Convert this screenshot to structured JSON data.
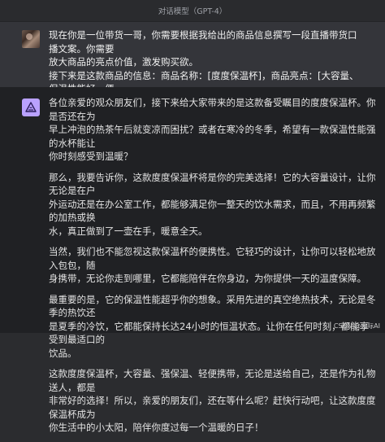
{
  "header": {
    "title": "对话模型（GPT-4）"
  },
  "user_message": {
    "text": "现在你是一位带货一哥，你需要根据我给出的商品信息撰写一段直播带货口播文案。你需要\n放大商品的亮点价值，激发购买欲。\n接下来是这款商品的信息：商品名称：[度度保温杯]，商品亮点：[大容量、保温性能好、便\n携性强]"
  },
  "assistant_message": {
    "paragraphs": [
      "各位亲爱的观众朋友们，接下来给大家带来的是这款备受瞩目的度度保温杯。你是否还在为\n早上冲泡的热茶午后就变凉而困扰？或者在寒冷的冬季，希望有一款保温性能强的水杯能让\n你时刻感受到温暖？",
      "那么，我要告诉你，这款度度保温杯将是你的完美选择！它的大容量设计，让你无论是在户\n外运动还是在办公室工作，都能够满足你一整天的饮水需求，而且，不用再频繁的加热或换\n水，真正做到了一壶在手，暖意全天。",
      "当然，我们也不能忽视这款保温杯的便携性。它轻巧的设计，让你可以轻松地放入包包，随\n身携带，无论你走到哪里，它都能陪伴在你身边，为你提供一天的温度保障。",
      "最重要的是，它的保温性能超乎你的想象。采用先进的真空绝热技术，无论是冬季的热饮还\n是夏季的冷饮，它都能保持长达24小时的恒温状态。让你在任何时刻，都能享受到最适口的\n饮品。",
      "这款度度保温杯，大容量、强保温、轻便携带，无论是送给自己，还是作为礼物送人，都是\n非常好的选择！所以，亲爱的朋友们，还在等什么呢？赶快行动吧，让这款度度保温杯成为\n你生活中的小太阳，陪伴你度过每一个温暖的日子！"
    ]
  },
  "watermark": {
    "text": "CSDN @无际AI"
  },
  "colors": {
    "ai_avatar_bg": "#b9a1ff",
    "user_row_bg": "#34353a",
    "assistant_row_bg": "#202124"
  },
  "icons": {
    "user_avatar": "user-avatar-photo",
    "ai_avatar": "ai-logo-icon"
  }
}
